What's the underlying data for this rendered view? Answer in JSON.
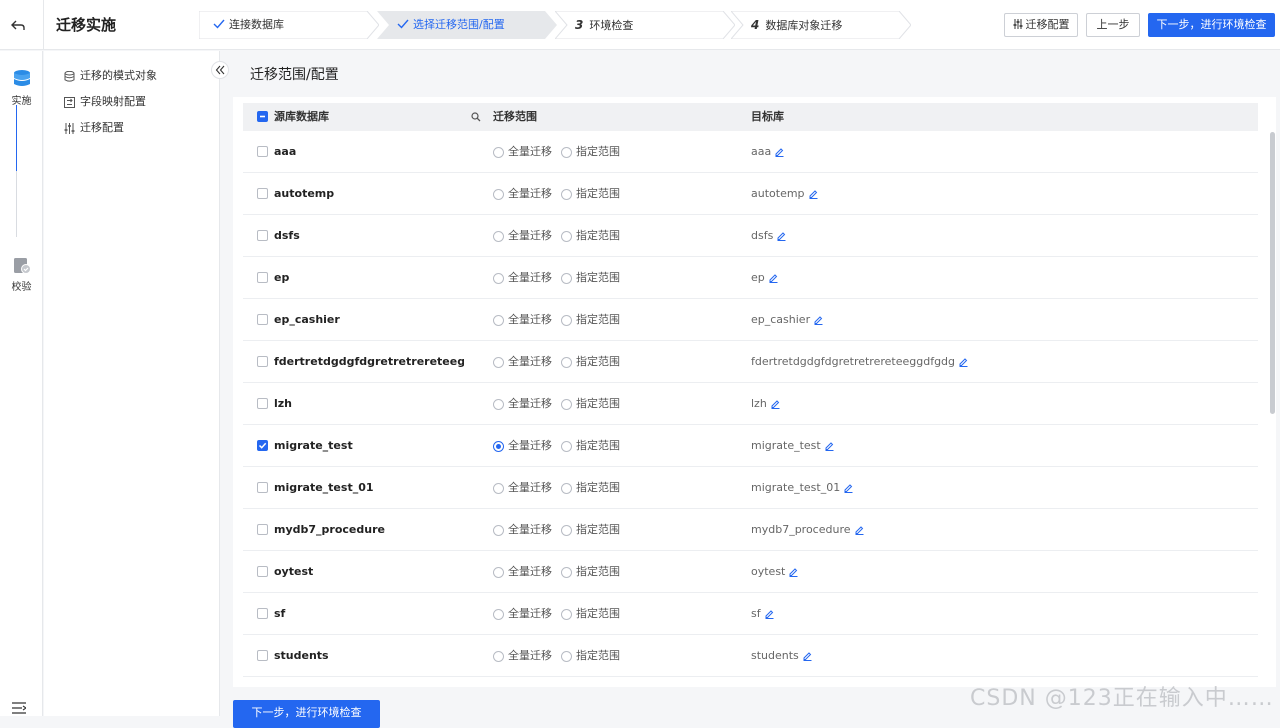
{
  "app": {
    "title": "迁移实施"
  },
  "steps": [
    {
      "num": "",
      "label": "连接数据库",
      "state": "done"
    },
    {
      "num": "",
      "label": "选择迁移范围/配置",
      "state": "active"
    },
    {
      "num": "3",
      "label": "环境检查",
      "state": "todo"
    },
    {
      "num": "4",
      "label": "数据库对象迁移",
      "state": "todo"
    }
  ],
  "header_buttons": {
    "config": "迁移配置",
    "prev": "上一步",
    "next": "下一步，进行环境检查"
  },
  "rail": {
    "implement": "实施",
    "verify": "校验"
  },
  "sidebar": {
    "items": [
      {
        "label": "迁移的模式对象",
        "icon": "database-icon"
      },
      {
        "label": "字段映射配置",
        "icon": "mapping-icon"
      },
      {
        "label": "迁移配置",
        "icon": "sliders-icon"
      }
    ]
  },
  "main": {
    "title": "迁移范围/配置"
  },
  "table": {
    "columns": {
      "source": "源库数据库",
      "scope": "迁移范围",
      "target": "目标库"
    },
    "scope_options": {
      "full": "全量迁移",
      "specified": "指定范围"
    },
    "rows": [
      {
        "name": "aaa",
        "target": "aaa",
        "checked": false,
        "scope": "none"
      },
      {
        "name": "autotemp",
        "target": "autotemp",
        "checked": false,
        "scope": "none"
      },
      {
        "name": "dsfs",
        "target": "dsfs",
        "checked": false,
        "scope": "none"
      },
      {
        "name": "ep",
        "target": "ep",
        "checked": false,
        "scope": "none"
      },
      {
        "name": "ep_cashier",
        "target": "ep_cashier",
        "checked": false,
        "scope": "none"
      },
      {
        "name": "fdertretdgdgfdgretretrereteeggdfg...",
        "target": "fdertretdgdgfdgretretrereteeggdfgdg",
        "checked": false,
        "scope": "none"
      },
      {
        "name": "lzh",
        "target": "lzh",
        "checked": false,
        "scope": "none"
      },
      {
        "name": "migrate_test",
        "target": "migrate_test",
        "checked": true,
        "scope": "full"
      },
      {
        "name": "migrate_test_01",
        "target": "migrate_test_01",
        "checked": false,
        "scope": "none"
      },
      {
        "name": "mydb7_procedure",
        "target": "mydb7_procedure",
        "checked": false,
        "scope": "none"
      },
      {
        "name": "oytest",
        "target": "oytest",
        "checked": false,
        "scope": "none"
      },
      {
        "name": "sf",
        "target": "sf",
        "checked": false,
        "scope": "none"
      },
      {
        "name": "students",
        "target": "students",
        "checked": false,
        "scope": "none"
      }
    ]
  },
  "bottom_button": "下一步，进行环境检查",
  "watermark": "CSDN @123正在输入中……",
  "colors": {
    "accent": "#2467f0"
  }
}
